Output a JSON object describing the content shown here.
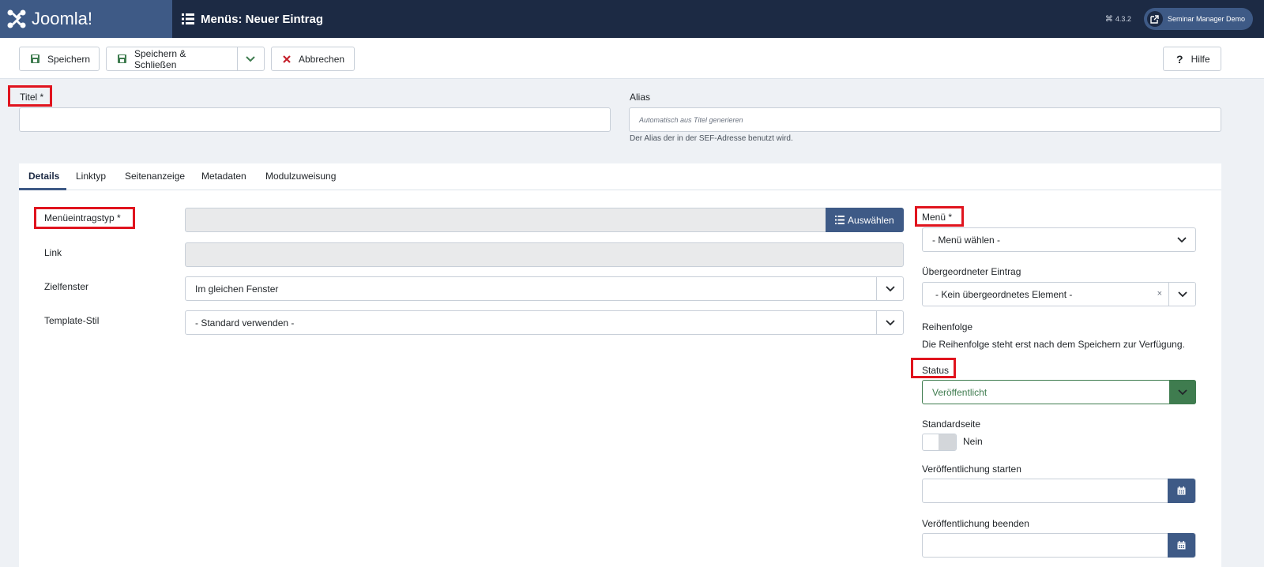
{
  "header": {
    "brand": "Joomla!",
    "page_title": "Menüs: Neuer Eintrag",
    "version": "4.3.2",
    "user": "Seminar Manager Demo"
  },
  "toolbar": {
    "save_label": "Speichern",
    "save_close_label": "Speichern & Schließen",
    "cancel_label": "Abbrechen",
    "help_label": "Hilfe"
  },
  "form": {
    "title_label": "Titel *",
    "title_value": "",
    "alias_label": "Alias",
    "alias_placeholder": "Automatisch aus Titel generieren",
    "alias_hint": "Der Alias der in der SEF-Adresse benutzt wird."
  },
  "tabs": [
    {
      "label": "Details",
      "active": true
    },
    {
      "label": "Linktyp",
      "active": false
    },
    {
      "label": "Seitenanzeige",
      "active": false
    },
    {
      "label": "Metadaten",
      "active": false
    },
    {
      "label": "Modulzuweisung",
      "active": false
    }
  ],
  "details": {
    "menu_item_type_label": "Menüeintragstyp *",
    "menu_item_type_value": "",
    "choose_button": "Auswählen",
    "link_label": "Link",
    "link_value": "",
    "target_window_label": "Zielfenster",
    "target_window_value": "Im gleichen Fenster",
    "template_style_label": "Template-Stil",
    "template_style_value": "- Standard verwenden -"
  },
  "sidebar": {
    "menu_label": "Menü *",
    "menu_value": "- Menü wählen -",
    "parent_label": "Übergeordneter Eintrag",
    "parent_value": "- Kein übergeordnetes Element -",
    "order_label": "Reihenfolge",
    "order_note": "Die Reihenfolge steht erst nach dem Speichern zur Verfügung.",
    "status_label": "Status",
    "status_value": "Veröffentlicht",
    "default_page_label": "Standardseite",
    "default_page_value": "Nein",
    "publish_up_label": "Veröffentlichung starten",
    "publish_up_value": "",
    "publish_down_label": "Veröffentlichung beenden",
    "publish_down_value": ""
  },
  "colors": {
    "header_bg": "#1c2a44",
    "brand_bg": "#3e5a86",
    "primary": "#3e5a86",
    "success": "#3f7c4f",
    "danger": "#c5202b",
    "highlight": "#e0141e"
  }
}
